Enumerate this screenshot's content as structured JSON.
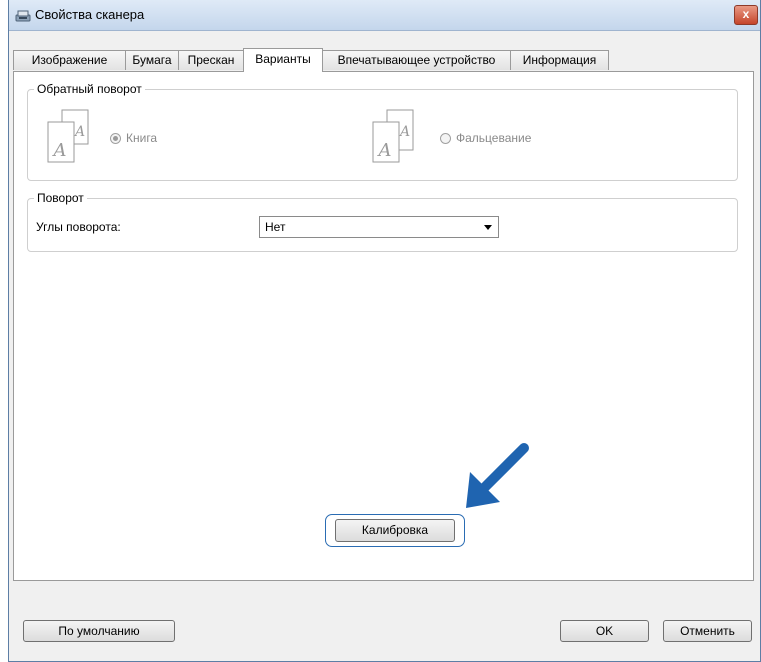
{
  "window": {
    "title": "Свойства сканера",
    "close_label": "x"
  },
  "tabs": [
    {
      "label": "Изображение",
      "active": false
    },
    {
      "label": "Бумага",
      "active": false
    },
    {
      "label": "Прескан",
      "active": false
    },
    {
      "label": "Варианты",
      "active": true
    },
    {
      "label": "Впечатывающее устройство",
      "active": false
    },
    {
      "label": "Информация",
      "active": false
    }
  ],
  "reverse_rotation": {
    "title": "Обратный поворот",
    "options": [
      {
        "label": "Книга",
        "selected": true,
        "enabled": false
      },
      {
        "label": "Фальцевание",
        "selected": false,
        "enabled": false
      }
    ]
  },
  "rotation": {
    "title": "Поворот",
    "angle_label": "Углы поворота:",
    "angle_value": "Нет"
  },
  "calibrate_label": "Калибровка",
  "footer": {
    "default_label": "По умолчанию",
    "ok_label": "OK",
    "cancel_label": "Отменить"
  },
  "colors": {
    "highlight": "#2a6cb3",
    "arrow": "#1f64b0"
  }
}
